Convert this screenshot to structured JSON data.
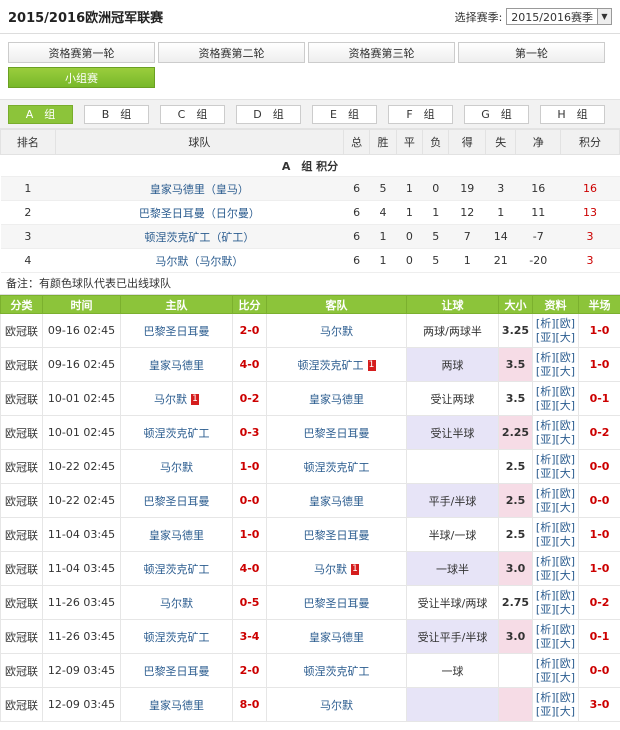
{
  "header": {
    "title": "2015/2016欧洲冠军联赛",
    "season_label": "选择赛季:",
    "season_value": "2015/2016赛季"
  },
  "rounds": [
    "资格赛第一轮",
    "资格赛第二轮",
    "资格赛第三轮",
    "第一轮",
    "小组赛"
  ],
  "groups": [
    "A　组",
    "B　组",
    "C　组",
    "D　组",
    "E　组",
    "F　组",
    "G　组",
    "H　组"
  ],
  "standings": {
    "headers": [
      "排名",
      "球队",
      "总",
      "胜",
      "平",
      "负",
      "得",
      "失",
      "净",
      "积分"
    ],
    "group_title": "A　组 积分",
    "rows": [
      {
        "rank": "1",
        "team": "皇家马德里（皇马）",
        "p": "6",
        "w": "5",
        "d": "1",
        "l": "0",
        "gf": "19",
        "ga": "3",
        "gd": "16",
        "pts": "16"
      },
      {
        "rank": "2",
        "team": "巴黎圣日耳曼（日尔曼）",
        "p": "6",
        "w": "4",
        "d": "1",
        "l": "1",
        "gf": "12",
        "ga": "1",
        "gd": "11",
        "pts": "13"
      },
      {
        "rank": "3",
        "team": "顿涅茨克矿工（矿工）",
        "p": "6",
        "w": "1",
        "d": "0",
        "l": "5",
        "gf": "7",
        "ga": "14",
        "gd": "-7",
        "pts": "3"
      },
      {
        "rank": "4",
        "team": "马尔默（马尔默）",
        "p": "6",
        "w": "1",
        "d": "0",
        "l": "5",
        "gf": "1",
        "ga": "21",
        "gd": "-20",
        "pts": "3"
      }
    ],
    "note": "备注：有颜色球队代表已出线球队"
  },
  "matches": {
    "headers": [
      "分类",
      "时间",
      "主队",
      "比分",
      "客队",
      "让球",
      "大小",
      "资料",
      "半场"
    ],
    "link_line1": "[析][欧]",
    "link_line2": "[亚][大]",
    "rows": [
      {
        "league": "欧冠联",
        "time": "09-16 02:45",
        "home": "巴黎圣日耳曼",
        "home_card": "",
        "score": "2-0",
        "away": "马尔默",
        "away_card": "",
        "handicap": "两球/两球半",
        "ou": "3.25",
        "half": "1-0",
        "hh": false,
        "oh": false
      },
      {
        "league": "欧冠联",
        "time": "09-16 02:45",
        "home": "皇家马德里",
        "home_card": "",
        "score": "4-0",
        "away": "顿涅茨克矿工",
        "away_card": "1",
        "handicap": "两球",
        "ou": "3.5",
        "half": "1-0",
        "hh": true,
        "oh": true
      },
      {
        "league": "欧冠联",
        "time": "10-01 02:45",
        "home": "马尔默",
        "home_card": "1",
        "score": "0-2",
        "away": "皇家马德里",
        "away_card": "",
        "handicap": "受让两球",
        "ou": "3.5",
        "half": "0-1",
        "hh": false,
        "oh": false
      },
      {
        "league": "欧冠联",
        "time": "10-01 02:45",
        "home": "顿涅茨克矿工",
        "home_card": "",
        "score": "0-3",
        "away": "巴黎圣日耳曼",
        "away_card": "",
        "handicap": "受让半球",
        "ou": "2.25",
        "half": "0-2",
        "hh": true,
        "oh": true
      },
      {
        "league": "欧冠联",
        "time": "10-22 02:45",
        "home": "马尔默",
        "home_card": "",
        "score": "1-0",
        "away": "顿涅茨克矿工",
        "away_card": "",
        "handicap": "",
        "ou": "2.5",
        "half": "0-0",
        "hh": false,
        "oh": false
      },
      {
        "league": "欧冠联",
        "time": "10-22 02:45",
        "home": "巴黎圣日耳曼",
        "home_card": "",
        "score": "0-0",
        "away": "皇家马德里",
        "away_card": "",
        "handicap": "平手/半球",
        "ou": "2.5",
        "half": "0-0",
        "hh": true,
        "oh": true
      },
      {
        "league": "欧冠联",
        "time": "11-04 03:45",
        "home": "皇家马德里",
        "home_card": "",
        "score": "1-0",
        "away": "巴黎圣日耳曼",
        "away_card": "",
        "handicap": "半球/一球",
        "ou": "2.5",
        "half": "1-0",
        "hh": false,
        "oh": false
      },
      {
        "league": "欧冠联",
        "time": "11-04 03:45",
        "home": "顿涅茨克矿工",
        "home_card": "",
        "score": "4-0",
        "away": "马尔默",
        "away_card": "1",
        "handicap": "一球半",
        "ou": "3.0",
        "half": "1-0",
        "hh": true,
        "oh": true
      },
      {
        "league": "欧冠联",
        "time": "11-26 03:45",
        "home": "马尔默",
        "home_card": "",
        "score": "0-5",
        "away": "巴黎圣日耳曼",
        "away_card": "",
        "handicap": "受让半球/两球",
        "ou": "2.75",
        "half": "0-2",
        "hh": false,
        "oh": false
      },
      {
        "league": "欧冠联",
        "time": "11-26 03:45",
        "home": "顿涅茨克矿工",
        "home_card": "",
        "score": "3-4",
        "away": "皇家马德里",
        "away_card": "",
        "handicap": "受让平手/半球",
        "ou": "3.0",
        "half": "0-1",
        "hh": true,
        "oh": true
      },
      {
        "league": "欧冠联",
        "time": "12-09 03:45",
        "home": "巴黎圣日耳曼",
        "home_card": "",
        "score": "2-0",
        "away": "顿涅茨克矿工",
        "away_card": "",
        "handicap": "一球",
        "ou": "",
        "half": "0-0",
        "hh": false,
        "oh": false
      },
      {
        "league": "欧冠联",
        "time": "12-09 03:45",
        "home": "皇家马德里",
        "home_card": "",
        "score": "8-0",
        "away": "马尔默",
        "away_card": "",
        "handicap": "",
        "ou": "",
        "half": "3-0",
        "hh": true,
        "oh": true
      }
    ]
  }
}
